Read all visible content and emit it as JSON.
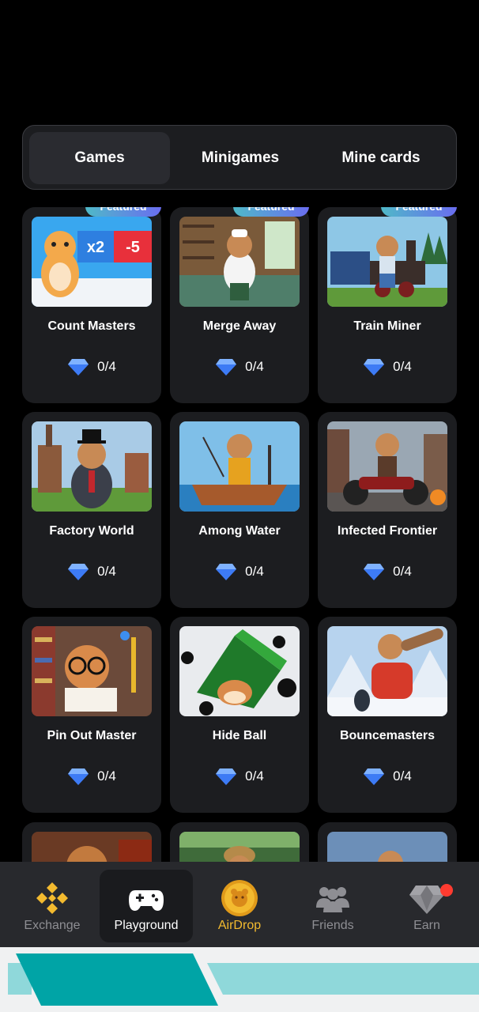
{
  "tabs": [
    {
      "label": "Games",
      "active": true
    },
    {
      "label": "Minigames",
      "active": false
    },
    {
      "label": "Mine cards",
      "active": false
    }
  ],
  "badge_label": "Featured",
  "games": [
    {
      "name": "Count Masters",
      "progress": "0/4",
      "featured": true
    },
    {
      "name": "Merge Away",
      "progress": "0/4",
      "featured": true
    },
    {
      "name": "Train Miner",
      "progress": "0/4",
      "featured": true
    },
    {
      "name": "Factory World",
      "progress": "0/4",
      "featured": false
    },
    {
      "name": "Among Water",
      "progress": "0/4",
      "featured": false
    },
    {
      "name": "Infected Frontier",
      "progress": "0/4",
      "featured": false
    },
    {
      "name": "Pin Out Master",
      "progress": "0/4",
      "featured": false
    },
    {
      "name": "Hide Ball",
      "progress": "0/4",
      "featured": false
    },
    {
      "name": "Bouncemasters",
      "progress": "0/4",
      "featured": false
    }
  ],
  "count_masters_art": {
    "multiplier": "x2",
    "penalty": "-5"
  },
  "nav": [
    {
      "label": "Exchange",
      "icon": "binance-icon",
      "active": false
    },
    {
      "label": "Playground",
      "icon": "gamepad-icon",
      "active": true
    },
    {
      "label": "AirDrop",
      "icon": "coin-icon",
      "active": false
    },
    {
      "label": "Friends",
      "icon": "friends-icon",
      "active": false
    },
    {
      "label": "Earn",
      "icon": "diamond-icon",
      "active": false
    }
  ],
  "colors": {
    "background": "#000000",
    "card": "#1c1d20",
    "nav": "#28292d",
    "gold": "#f3ba2f",
    "badge_start": "#4fb9c8",
    "badge_end": "#6a6df0",
    "notification": "#ff3b30",
    "teal": "#00a4a6"
  }
}
